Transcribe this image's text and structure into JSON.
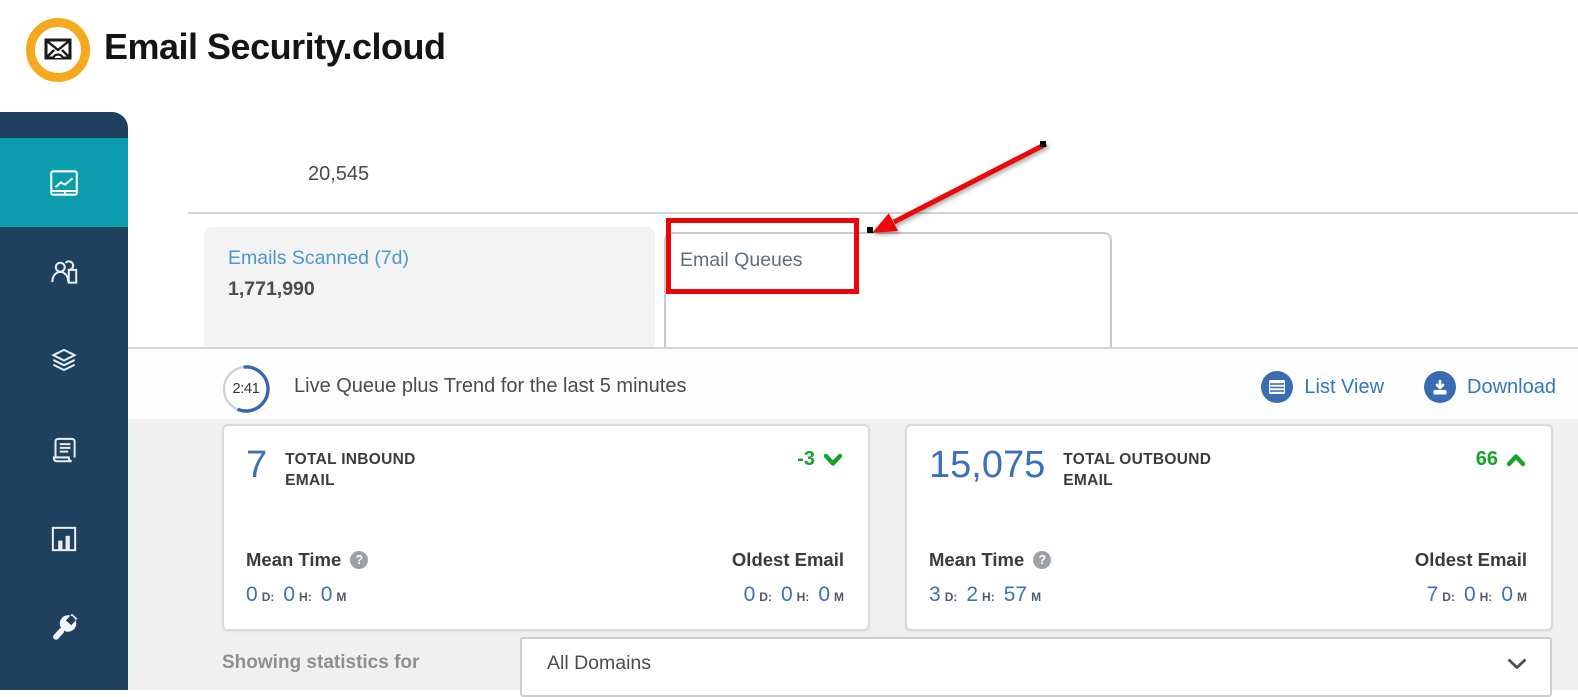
{
  "header": {
    "title": "Email Security.cloud"
  },
  "sidebar": {
    "items": [
      {
        "id": "dashboard",
        "active": true
      },
      {
        "id": "users",
        "active": false
      },
      {
        "id": "services",
        "active": false
      },
      {
        "id": "logs",
        "active": false
      },
      {
        "id": "reports",
        "active": false
      },
      {
        "id": "tools",
        "active": false
      }
    ]
  },
  "top_metric": {
    "value": "20,545"
  },
  "tabs": {
    "emails_scanned": {
      "label": "Emails Scanned (7d)",
      "value": "1,771,990"
    },
    "email_queues": {
      "label": "Email Queues"
    }
  },
  "queue_bar": {
    "timer": "2:41",
    "title": "Live Queue plus Trend for the last 5 minutes",
    "list_view": "List View",
    "download": "Download"
  },
  "units": {
    "d": "D:",
    "h": "H:",
    "m": "M"
  },
  "misc": {
    "help": "?"
  },
  "cards": [
    {
      "value": "7",
      "label_line1": "TOTAL INBOUND",
      "label_line2": "EMAIL",
      "delta": "-3",
      "delta_direction": "down",
      "mean_time_label": "Mean Time",
      "oldest_label": "Oldest Email",
      "mean_time": {
        "d": "0",
        "h": "0",
        "m": "0"
      },
      "oldest": {
        "d": "0",
        "h": "0",
        "m": "0"
      }
    },
    {
      "value": "15,075",
      "label_line1": "TOTAL OUTBOUND",
      "label_line2": "EMAIL",
      "delta": "66",
      "delta_direction": "up",
      "mean_time_label": "Mean Time",
      "oldest_label": "Oldest Email",
      "mean_time": {
        "d": "3",
        "h": "2",
        "m": "57"
      },
      "oldest": {
        "d": "7",
        "h": "0",
        "m": "0"
      }
    }
  ],
  "stats_filter": {
    "label": "Showing statistics for",
    "selected": "All Domains"
  },
  "annotation": {
    "highlight_target": "Email Queues tab"
  },
  "colors": {
    "navy": "#20405f",
    "teal": "#0b9cad",
    "accent_blue": "#3b70ba",
    "link_blue": "#3078be",
    "green": "#15a32a",
    "red": "#eb0508",
    "brand_yellow": "#f6a81f"
  }
}
